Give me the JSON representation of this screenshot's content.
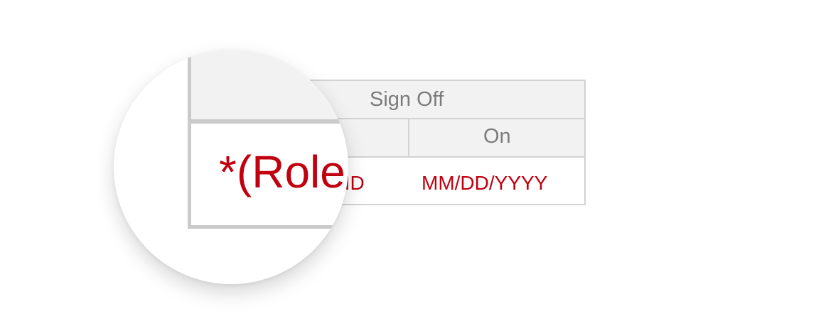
{
  "signoff": {
    "header": "Sign Off",
    "sub_header_on": "On",
    "value_id": "er ID",
    "value_date": "MM/DD/YYYY"
  },
  "magnifier": {
    "text": "*(Role"
  },
  "colors": {
    "accent_red": "#c0000f",
    "header_bg": "#f2f2f2",
    "border": "#d2d2d2",
    "header_text": "#7c7c7c"
  }
}
